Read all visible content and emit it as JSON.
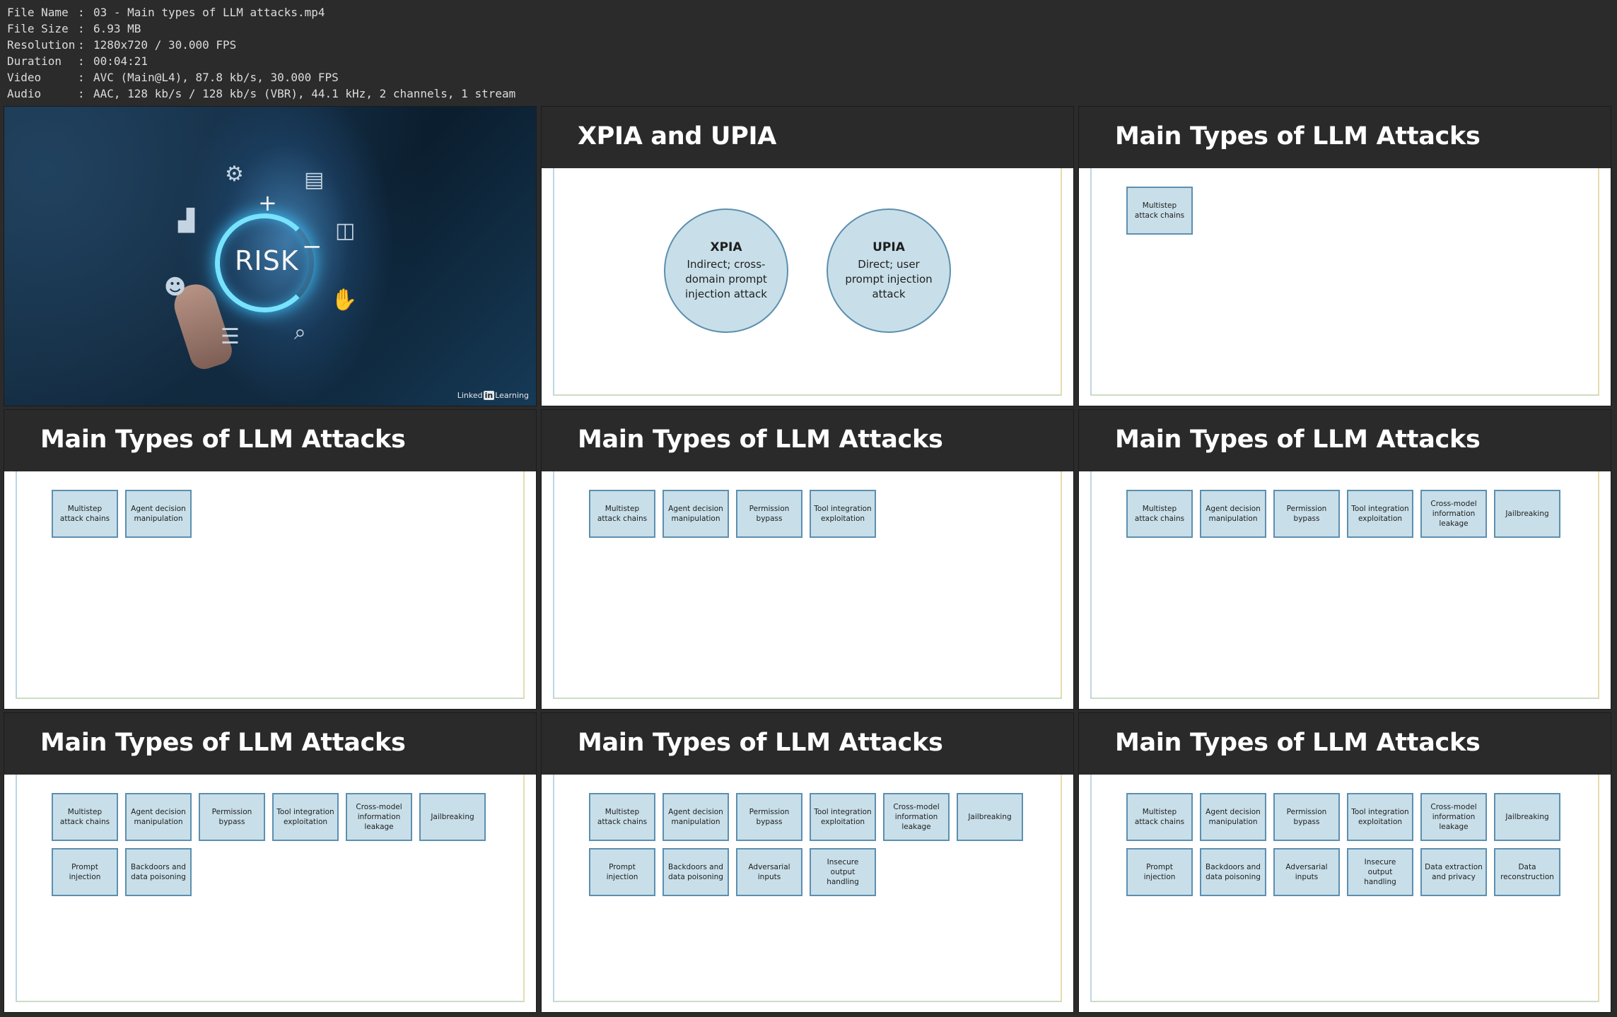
{
  "meta": [
    {
      "label": "File Name",
      "value": "03 - Main types of LLM attacks.mp4"
    },
    {
      "label": "File Size",
      "value": "6.93 MB"
    },
    {
      "label": "Resolution",
      "value": "1280x720 / 30.000 FPS"
    },
    {
      "label": "Duration",
      "value": "00:04:21"
    },
    {
      "label": "Video",
      "value": "AVC (Main@L4), 87.8 kb/s, 30.000 FPS"
    },
    {
      "label": "Audio",
      "value": "AAC, 128 kb/s / 128 kb/s (VBR), 44.1 kHz, 2 channels, 1 stream"
    }
  ],
  "frame1": {
    "risk": "RISK",
    "plus": "+",
    "minus": "−",
    "brand_pre": "Linked",
    "brand_in": "in",
    "brand_post": "Learning"
  },
  "frame2": {
    "title": "XPIA and UPIA",
    "circles": [
      {
        "title": "XPIA",
        "desc": "Indirect; cross-domain prompt injection attack"
      },
      {
        "title": "UPIA",
        "desc": "Direct; user prompt injection attack"
      }
    ]
  },
  "attacks_title": "Main Types of LLM Attacks",
  "attacks": [
    "Multistep attack chains",
    "Agent decision manipulation",
    "Permission bypass",
    "Tool integration exploitation",
    "Cross-model information leakage",
    "Jailbreaking",
    "Prompt injection",
    "Backdoors and data poisoning",
    "Adversarial inputs",
    "Insecure output handling",
    "Data extraction and privacy",
    "Data reconstruction"
  ],
  "frames_card_counts": [
    1,
    2,
    4,
    6,
    8,
    10,
    12
  ]
}
